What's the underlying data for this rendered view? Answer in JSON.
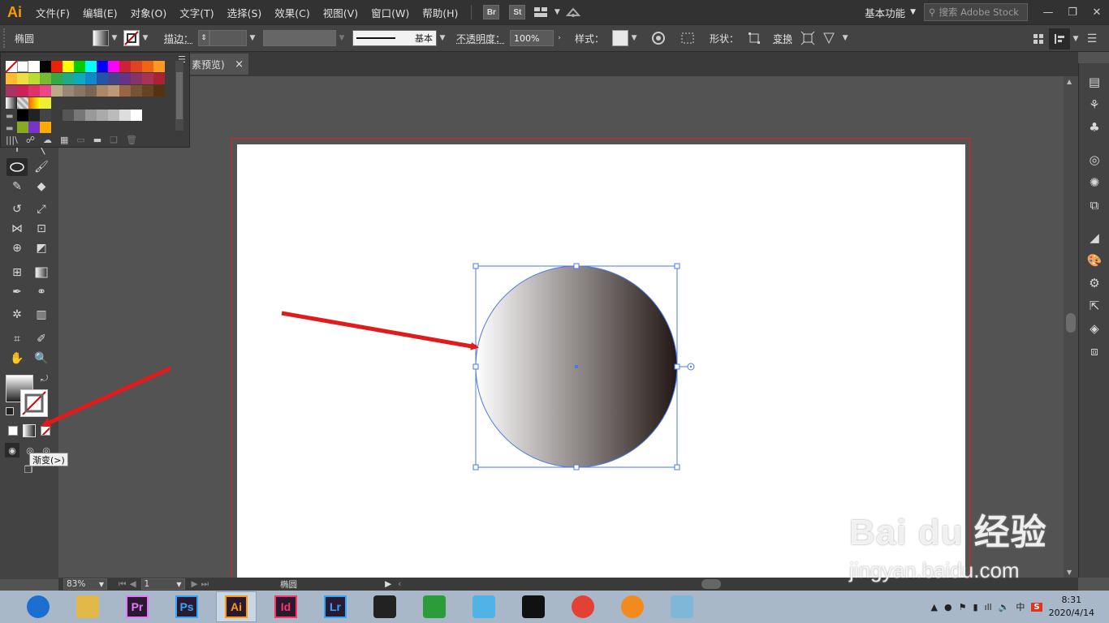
{
  "app": {
    "logo": "Ai",
    "menus": [
      "文件(F)",
      "编辑(E)",
      "对象(O)",
      "文字(T)",
      "选择(S)",
      "效果(C)",
      "视图(V)",
      "窗口(W)",
      "帮助(H)"
    ],
    "bridge_badge": "Br",
    "stock_badge": "St",
    "workspace": "基本功能",
    "search_placeholder": "搜索 Adobe Stock"
  },
  "control_bar": {
    "object_type": "椭圆",
    "stroke_label": "描边：",
    "stroke_profile": "基本",
    "opacity_label": "不透明度：",
    "opacity_value": "100%",
    "style_label": "样式：",
    "shape_label": "形状：",
    "transform_label": "变换"
  },
  "document": {
    "tab_title": "素预览)",
    "tab_close": "×"
  },
  "tooltip": {
    "text": "渐变(>)"
  },
  "status_bar": {
    "zoom": "83%",
    "page": "1",
    "object": "椭圆"
  },
  "watermark": {
    "line1": "Bai  du 经验",
    "line2": "jingyan.baidu.com"
  },
  "taskbar": {
    "apps": [
      {
        "name": "browser-ie",
        "label": "",
        "color": "#1a6fd1"
      },
      {
        "name": "file-explorer",
        "label": "",
        "color": "#e3b84a"
      },
      {
        "name": "premiere",
        "label": "Pr",
        "color": "#ea77ff"
      },
      {
        "name": "photoshop",
        "label": "Ps",
        "color": "#31a8ff"
      },
      {
        "name": "illustrator",
        "label": "Ai",
        "color": "#ff9a00"
      },
      {
        "name": "indesign",
        "label": "Id",
        "color": "#ff3366"
      },
      {
        "name": "lightroom",
        "label": "Lr",
        "color": "#31a8ff"
      },
      {
        "name": "video-editor",
        "label": "",
        "color": "#222"
      },
      {
        "name": "color-app",
        "label": "",
        "color": "#2a9d3a"
      },
      {
        "name": "bird-app",
        "label": "",
        "color": "#4fb3e8"
      },
      {
        "name": "qq",
        "label": "",
        "color": "#111"
      },
      {
        "name": "chrome",
        "label": "",
        "color": "#e34133"
      },
      {
        "name": "orange-app",
        "label": "",
        "color": "#f28a1e"
      },
      {
        "name": "notes-app",
        "label": "",
        "color": "#7fb7d9"
      }
    ],
    "time": "8:31",
    "date": "2020/4/14",
    "ime": "中"
  },
  "colors": {
    "accent_orange": "#ff9a00",
    "selection_blue": "#4a78e8",
    "arrow_red": "#e11b1b",
    "gradient_start": "#ffffff",
    "gradient_end": "#231815"
  }
}
